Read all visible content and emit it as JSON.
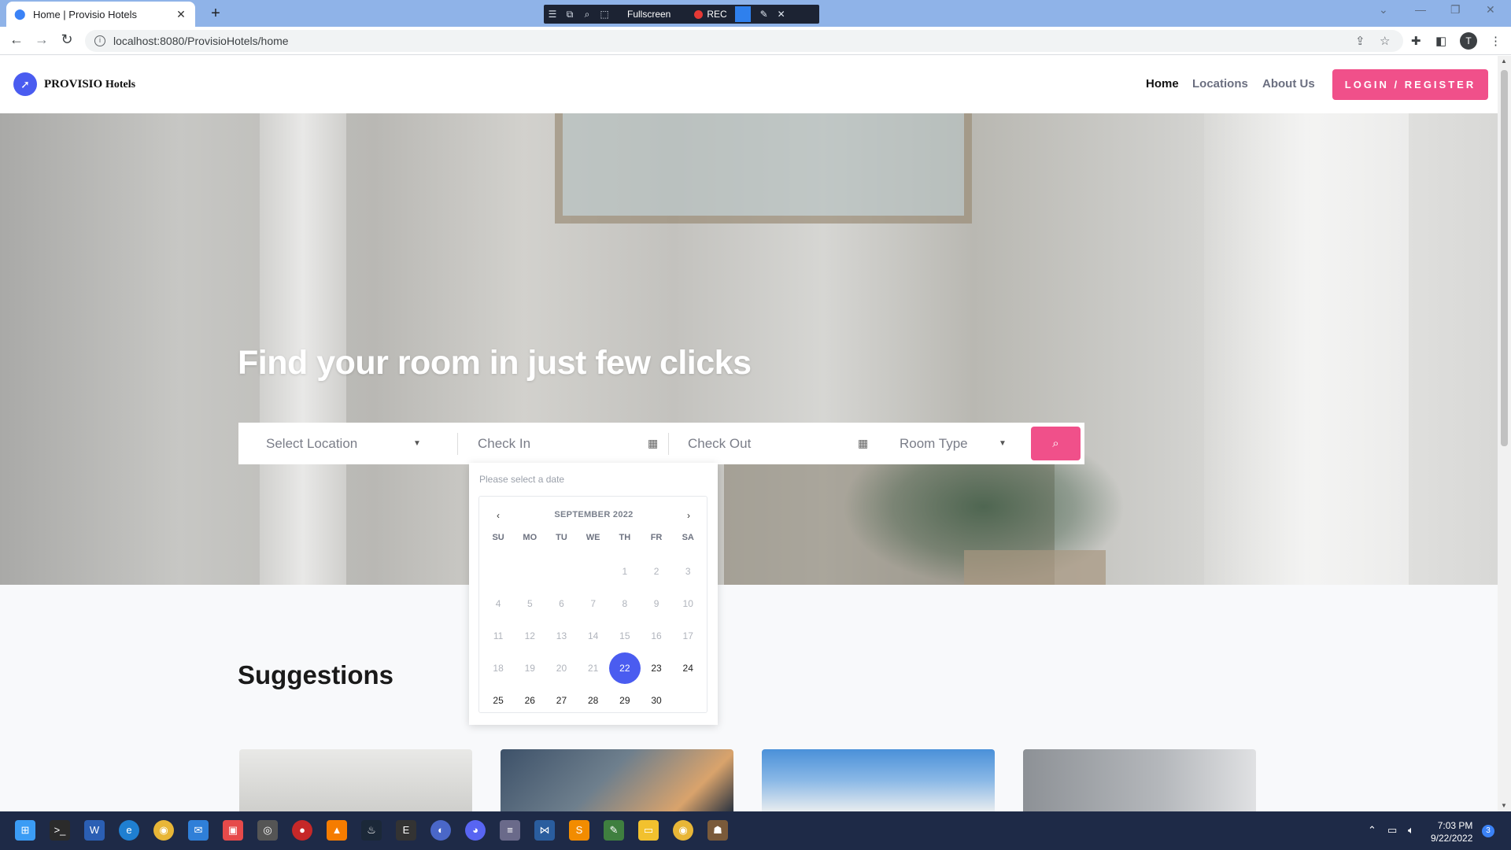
{
  "browser": {
    "tab_title": "Home | Provisio Hotels",
    "tab_close": "✕",
    "new_tab": "+",
    "url": "localhost:8080/ProvisioHotels/home",
    "profile_initial": "T"
  },
  "recorder": {
    "mode_label": "Fullscreen",
    "rec_label": "REC"
  },
  "site": {
    "brand_bold": "PROVISIO",
    "brand_rest": "Hotels",
    "nav": {
      "home": "Home",
      "locations": "Locations",
      "about": "About Us",
      "login": "LOGIN / REGISTER"
    },
    "hero_title": "Find your room in just few clicks",
    "search": {
      "location_placeholder": "Select Location",
      "check_in_placeholder": "Check In",
      "check_out_placeholder": "Check Out",
      "room_type_placeholder": "Room Type"
    },
    "datepicker": {
      "hint": "Please select a date",
      "month": "SEPTEMBER 2022",
      "weekdays": [
        "SU",
        "MO",
        "TU",
        "WE",
        "TH",
        "FR",
        "SA"
      ],
      "selected_day": "22",
      "weeks": [
        [
          "",
          "",
          "",
          "",
          "1",
          "2",
          "3"
        ],
        [
          "4",
          "5",
          "6",
          "7",
          "8",
          "9",
          "10"
        ],
        [
          "11",
          "12",
          "13",
          "14",
          "15",
          "16",
          "17"
        ],
        [
          "18",
          "19",
          "20",
          "21",
          "22",
          "23",
          "24"
        ],
        [
          "25",
          "26",
          "27",
          "28",
          "29",
          "30",
          ""
        ]
      ],
      "first_available": 22
    },
    "suggestions_title": "Suggestions"
  },
  "taskbar": {
    "time": "7:03 PM",
    "date": "9/22/2022",
    "notification_count": "3"
  },
  "colors": {
    "accent_pink": "#f0508a",
    "accent_blue": "#4a5cf0"
  }
}
